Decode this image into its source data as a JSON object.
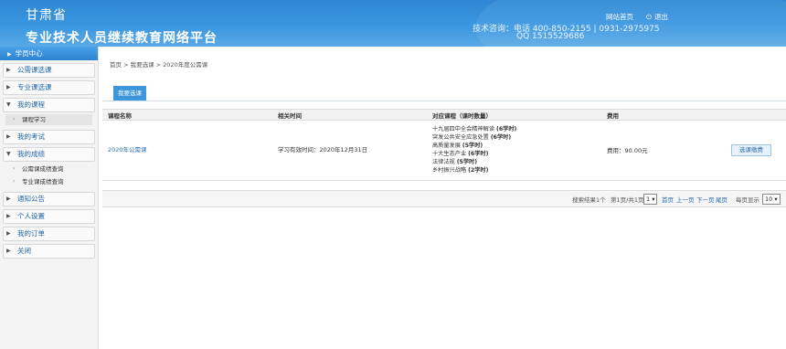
{
  "header": {
    "title_line1": "甘肃省",
    "title_line2": "专业技术人员继续教育网络平台",
    "link_home": "网站首页",
    "link_logout": "退出",
    "contact_line1": "技术咨询：电话 400-850-2155 | 0931-2975975",
    "contact_line2": "QQ  1515529686",
    "accent": "#2e87d4"
  },
  "sidebar": {
    "head": "学员中心",
    "items": [
      {
        "label": "公需课选课"
      },
      {
        "label": "专业课选课"
      },
      {
        "label": "我的课程",
        "open": true
      },
      {
        "label": "我的考试"
      },
      {
        "label": "我的成绩",
        "open": true
      },
      {
        "label": "通知公告"
      },
      {
        "label": "个人设置"
      },
      {
        "label": "我的订单"
      },
      {
        "label": "关闭"
      }
    ],
    "sub_course": "课程学习",
    "sub_score1": "公需课成绩查询",
    "sub_score2": "专业课成绩查询"
  },
  "main": {
    "breadcrumb": "首页 > 我要选课 > 2020年度公需课",
    "tab": "我要选课",
    "columns": [
      "课程名称",
      "相关时间",
      "对应课程（课时数量）",
      "费用"
    ],
    "row": {
      "course_name": "2020年公需课",
      "validity": "学习有效时间：2020年12月31日",
      "courses": [
        {
          "name": "十九届四中全会精神解读",
          "hours": "(6学时)"
        },
        {
          "name": "突发公共安全应急处置",
          "hours": "(6学时)"
        },
        {
          "name": "高质量发展",
          "hours": "(5学时)"
        },
        {
          "name": "十大生态产业",
          "hours": "(6学时)"
        },
        {
          "name": "法律法规",
          "hours": "(5学时)"
        },
        {
          "name": "乡村振兴战略",
          "hours": "(2学时)"
        }
      ],
      "fee": "费用：90.00元",
      "select_button": "选课缴费"
    },
    "pager": {
      "result": "搜索结果1个",
      "page_info_prefix": "第1页/共1页",
      "page_value": "1",
      "first": "首页",
      "prev": "上一页",
      "next": "下一页",
      "last": "尾页",
      "per_page_label": "每页显示",
      "per_page_value": "10"
    }
  }
}
